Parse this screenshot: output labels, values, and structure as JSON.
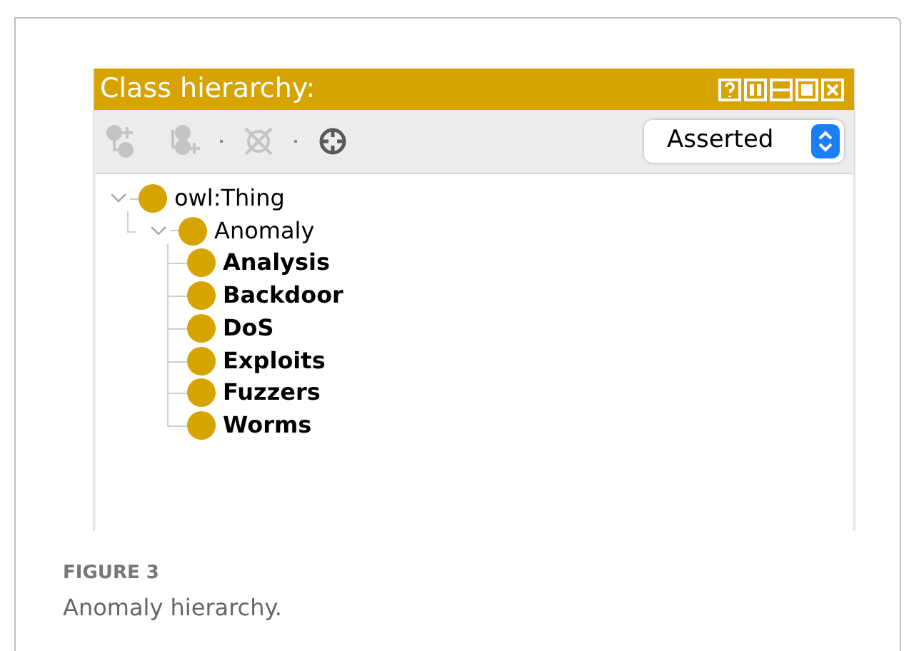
{
  "panel": {
    "title": "Class hierarchy:",
    "toolbar": [
      {
        "kind": "add-subclass",
        "disabled": true
      },
      {
        "kind": "add-sibling",
        "disabled": true
      },
      {
        "kind": "delete",
        "disabled": true
      },
      {
        "kind": "target",
        "disabled": false
      }
    ],
    "view_select": {
      "value": "Asserted"
    },
    "tree": [
      {
        "label": "owl:Thing",
        "bold": false,
        "expanded": true,
        "children": [
          {
            "label": "Anomaly",
            "bold": false,
            "expanded": true,
            "children": [
              {
                "label": "Analysis",
                "bold": true
              },
              {
                "label": "Backdoor",
                "bold": true
              },
              {
                "label": "DoS",
                "bold": true
              },
              {
                "label": "Exploits",
                "bold": true
              },
              {
                "label": "Fuzzers",
                "bold": true
              },
              {
                "label": "Worms",
                "bold": true
              }
            ]
          }
        ]
      }
    ]
  },
  "caption": {
    "label": "FIGURE 3",
    "text": "Anomaly hierarchy."
  }
}
